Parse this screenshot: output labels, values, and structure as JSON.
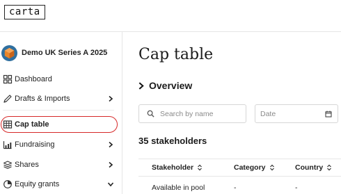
{
  "app": {
    "logo_text": "carta"
  },
  "company": {
    "name": "Demo UK Series A 2025",
    "avatar_icon": "company-avatar-icon"
  },
  "sidebar": {
    "items": [
      {
        "label": "Dashboard",
        "icon": "grid-icon",
        "has_chevron": false,
        "chevron": ""
      },
      {
        "label": "Drafts & Imports",
        "icon": "pencil-icon",
        "has_chevron": true,
        "chevron": "chevron-right-icon"
      },
      {
        "label": "Cap table",
        "icon": "table-icon",
        "has_chevron": false,
        "chevron": "",
        "active": true
      },
      {
        "label": "Fundraising",
        "icon": "bar-chart-icon",
        "has_chevron": true,
        "chevron": "chevron-right-icon"
      },
      {
        "label": "Shares",
        "icon": "stack-icon",
        "has_chevron": true,
        "chevron": "chevron-right-icon"
      },
      {
        "label": "Equity grants",
        "icon": "pie-icon",
        "has_chevron": true,
        "chevron": "chevron-down-icon"
      }
    ]
  },
  "main": {
    "title": "Cap table",
    "overview_label": "Overview",
    "search_placeholder": "Search by name",
    "date_placeholder": "Date",
    "stakeholders_label": "35 stakeholders",
    "table": {
      "columns": [
        "Stakeholder",
        "Category",
        "Country"
      ],
      "rows": [
        [
          "Available in pool",
          "-",
          "-"
        ]
      ]
    }
  },
  "colors": {
    "highlight_ring": "#d62828",
    "avatar_orange": "#e8862a",
    "avatar_blue": "#2f6f9f"
  }
}
